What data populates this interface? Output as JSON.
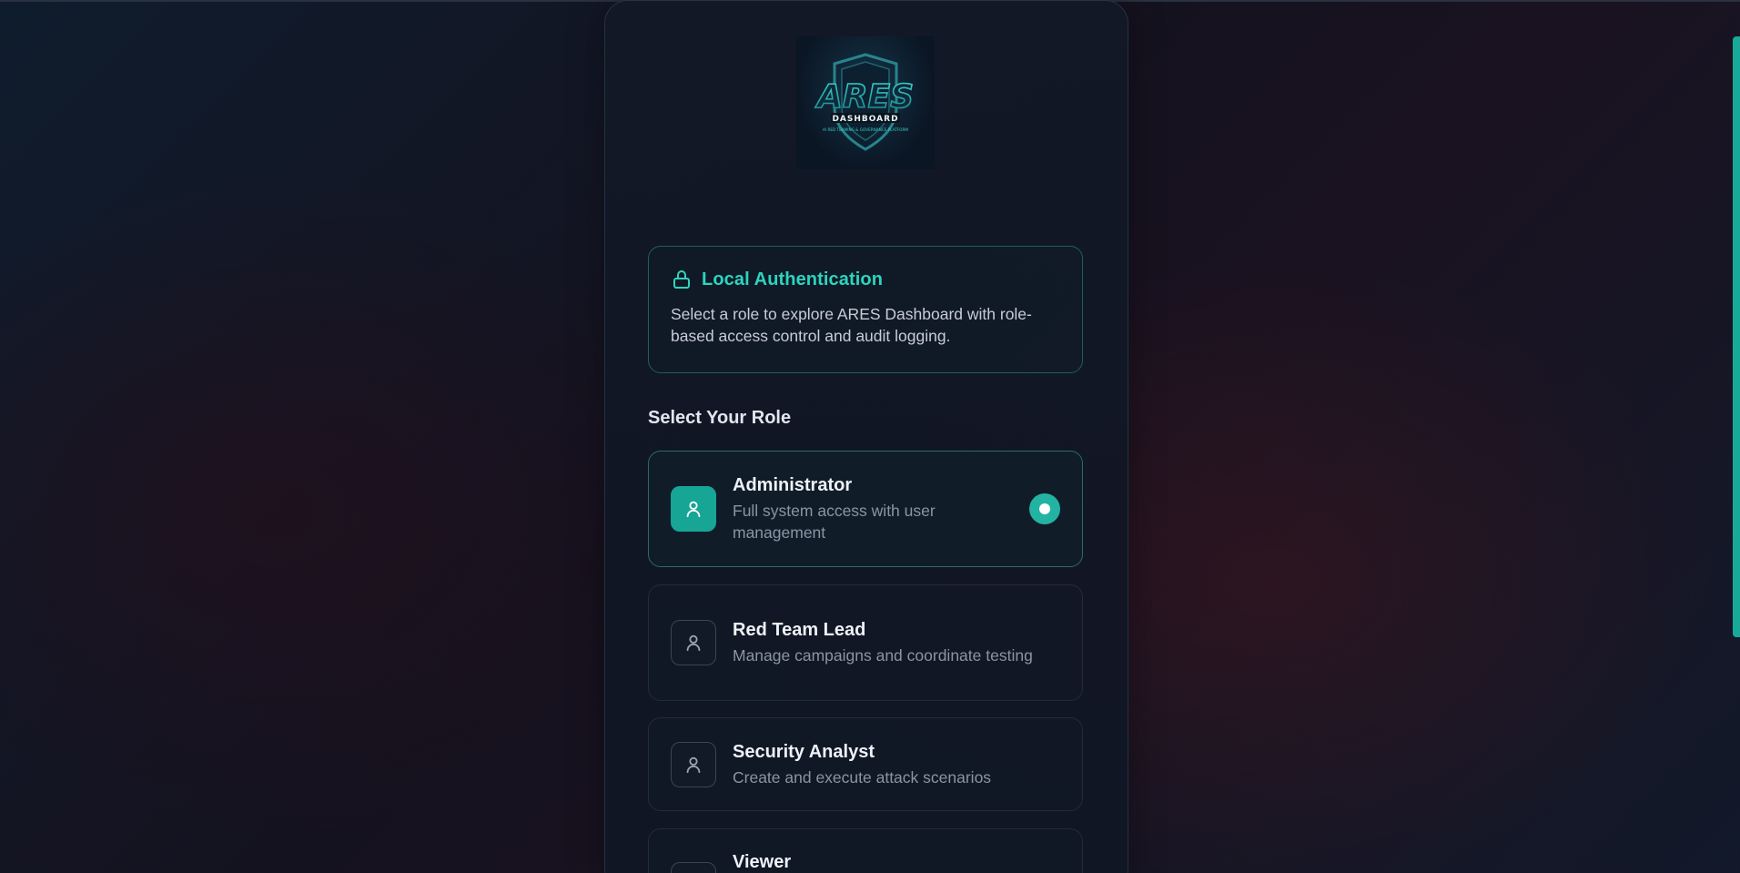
{
  "logo": {
    "wordmark": "ARES",
    "subtitle": "DASHBOARD",
    "tagline": "AI RED TEAMING & GOVERNANCE PLATFORM"
  },
  "auth": {
    "icon": "lock-icon",
    "title": "Local Authentication",
    "description": "Select a role to explore ARES Dashboard with role-based access control and audit logging."
  },
  "roles_section": {
    "title": "Select Your Role",
    "roles": [
      {
        "name": "Administrator",
        "description": "Full system access with user management",
        "selected": true
      },
      {
        "name": "Red Team Lead",
        "description": "Manage campaigns and coordinate testing",
        "selected": false
      },
      {
        "name": "Security Analyst",
        "description": "Create and execute attack scenarios",
        "selected": false
      },
      {
        "name": "Viewer",
        "description": "",
        "selected": false
      }
    ]
  },
  "colors": {
    "accent": "#2dd4bf",
    "selected_icon_bg": "#17a596",
    "radio": "#23b3a3"
  }
}
